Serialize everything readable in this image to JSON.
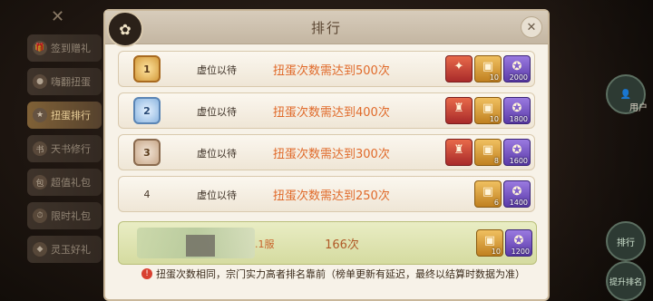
{
  "panel": {
    "title": "排行"
  },
  "sidebar": {
    "items": [
      {
        "label": "签到赠礼",
        "icon": "gift-icon"
      },
      {
        "label": "嗨翻扭蛋",
        "icon": "capsule-icon"
      },
      {
        "label": "扭蛋排行",
        "icon": "ranking-icon",
        "active": true
      },
      {
        "label": "天书修行",
        "icon": "book-icon"
      },
      {
        "label": "超值礼包",
        "icon": "package-icon"
      },
      {
        "label": "限时礼包",
        "icon": "timer-icon"
      },
      {
        "label": "灵玉好礼",
        "icon": "jade-icon"
      }
    ]
  },
  "rows": [
    {
      "rank": "1",
      "name": "虚位以待",
      "requirement": "扭蛋次数需达到500次",
      "rewards": [
        {
          "type": "red",
          "count": ""
        },
        {
          "type": "gold",
          "count": "10"
        },
        {
          "type": "purple",
          "count": "2000"
        }
      ]
    },
    {
      "rank": "2",
      "name": "虚位以待",
      "requirement": "扭蛋次数需达到400次",
      "rewards": [
        {
          "type": "red",
          "count": ""
        },
        {
          "type": "gold",
          "count": "10"
        },
        {
          "type": "purple",
          "count": "1800"
        }
      ]
    },
    {
      "rank": "3",
      "name": "虚位以待",
      "requirement": "扭蛋次数需达到300次",
      "rewards": [
        {
          "type": "red",
          "count": ""
        },
        {
          "type": "gold",
          "count": "8"
        },
        {
          "type": "purple",
          "count": "1600"
        }
      ]
    },
    {
      "rank": "4",
      "name": "虚位以待",
      "requirement": "扭蛋次数需达到250次",
      "rewards": [
        {
          "type": "gold",
          "count": "6"
        },
        {
          "type": "purple",
          "count": "1400"
        }
      ]
    }
  ],
  "my_row": {
    "server": ".1服",
    "count": "166次",
    "rewards": [
      {
        "type": "gold",
        "count": "10"
      },
      {
        "type": "purple",
        "count": "1200"
      }
    ]
  },
  "note": "扭蛋次数相同，宗门实力高者排名靠前（榜单更新有延迟，最终以结算时数据为准）",
  "right_buttons": {
    "ranking": "排行",
    "rank_up": "提升排名",
    "user": "用户"
  }
}
